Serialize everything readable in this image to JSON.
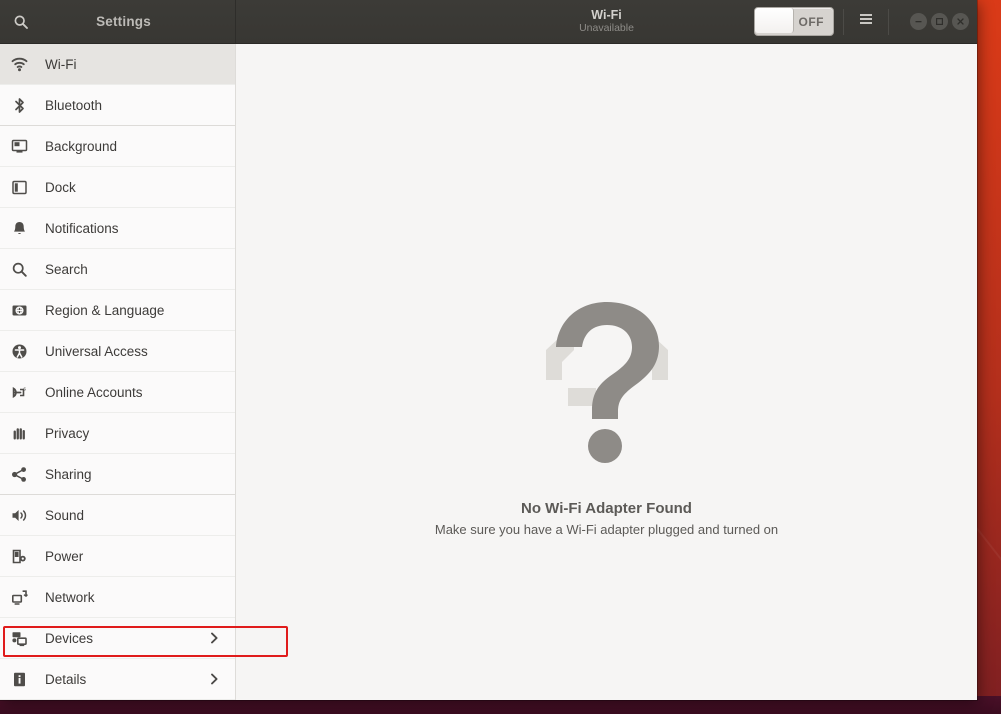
{
  "desktop": {
    "wallpaper_top_color": "#e8441a",
    "wallpaper_bottom_color": "#4a1028"
  },
  "titlebar": {
    "app_title": "Settings",
    "search_icon": "search-icon",
    "panel_title": "Wi-Fi",
    "panel_subtitle": "Unavailable",
    "toggle": {
      "label": "OFF",
      "state": "off"
    },
    "menu_icon": "hamburger-menu-icon",
    "window_controls": [
      {
        "name": "minimize-button",
        "glyph": "minimize-icon"
      },
      {
        "name": "maximize-button",
        "glyph": "maximize-icon"
      },
      {
        "name": "close-button",
        "glyph": "close-icon"
      }
    ]
  },
  "sidebar": {
    "items": [
      {
        "label": "Wi-Fi",
        "icon": "wifi-icon",
        "selected": true,
        "chevron": false,
        "group_end": false
      },
      {
        "label": "Bluetooth",
        "icon": "bluetooth-icon",
        "selected": false,
        "chevron": false,
        "group_end": true
      },
      {
        "label": "Background",
        "icon": "background-icon",
        "selected": false,
        "chevron": false,
        "group_end": false
      },
      {
        "label": "Dock",
        "icon": "dock-icon",
        "selected": false,
        "chevron": false,
        "group_end": false
      },
      {
        "label": "Notifications",
        "icon": "bell-icon",
        "selected": false,
        "chevron": false,
        "group_end": false
      },
      {
        "label": "Search",
        "icon": "search-icon",
        "selected": false,
        "chevron": false,
        "group_end": false
      },
      {
        "label": "Region & Language",
        "icon": "region-language-icon",
        "selected": false,
        "chevron": false,
        "group_end": false
      },
      {
        "label": "Universal Access",
        "icon": "universal-access-icon",
        "selected": false,
        "chevron": false,
        "group_end": false
      },
      {
        "label": "Online Accounts",
        "icon": "online-accounts-icon",
        "selected": false,
        "chevron": false,
        "group_end": false
      },
      {
        "label": "Privacy",
        "icon": "privacy-hand-icon",
        "selected": false,
        "chevron": false,
        "group_end": false
      },
      {
        "label": "Sharing",
        "icon": "sharing-icon",
        "selected": false,
        "chevron": false,
        "group_end": true
      },
      {
        "label": "Sound",
        "icon": "sound-icon",
        "selected": false,
        "chevron": false,
        "group_end": false
      },
      {
        "label": "Power",
        "icon": "power-icon",
        "selected": false,
        "chevron": false,
        "group_end": false
      },
      {
        "label": "Network",
        "icon": "network-icon",
        "selected": false,
        "chevron": false,
        "group_end": false
      },
      {
        "label": "Devices",
        "icon": "devices-icon",
        "selected": false,
        "chevron": true,
        "group_end": false
      },
      {
        "label": "Details",
        "icon": "details-info-icon",
        "selected": false,
        "chevron": true,
        "group_end": false
      }
    ]
  },
  "content": {
    "empty_state_icon": "question-mark-icon",
    "title": "No Wi-Fi Adapter Found",
    "subtitle": "Make sure you have a Wi-Fi adapter plugged and turned on"
  },
  "annotation": {
    "target": "Devices",
    "color": "#e01b1b"
  }
}
